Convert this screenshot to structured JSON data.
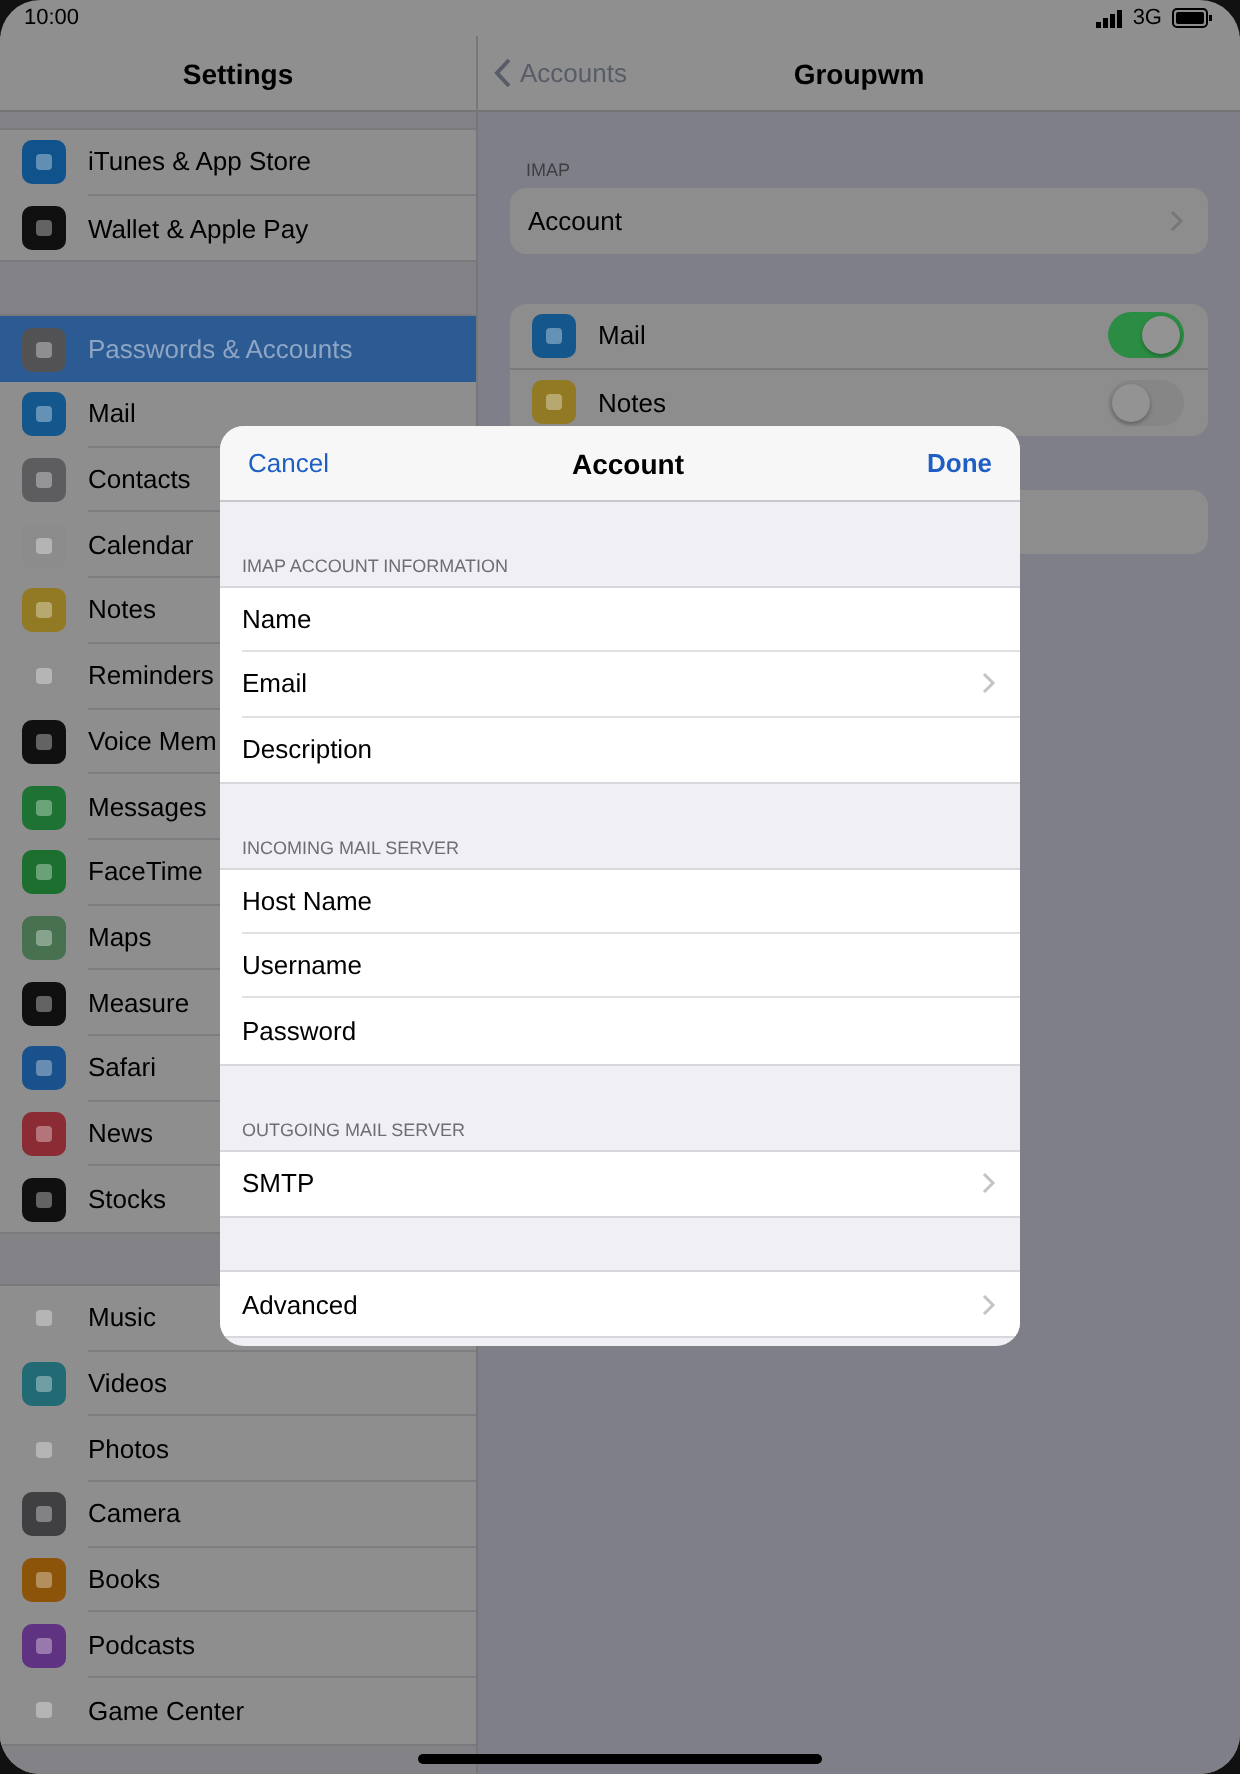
{
  "status_bar": {
    "time": "10:00",
    "network": "3G"
  },
  "sidebar": {
    "title": "Settings",
    "groups": [
      [
        {
          "label": "iTunes & App Store",
          "color": "#10528b",
          "selected": false
        },
        {
          "label": "Wallet & Apple Pay",
          "color": "#101011",
          "selected": false
        }
      ],
      [
        {
          "label": "Passwords & Accounts",
          "color": "#525255",
          "selected": true
        },
        {
          "label": "Mail",
          "color": "#13578d",
          "selected": false
        },
        {
          "label": "Contacts",
          "color": "#5d5d60",
          "selected": false
        },
        {
          "label": "Calendar",
          "color": "#8c8c8c",
          "selected": false
        },
        {
          "label": "Notes",
          "color": "#917a23",
          "selected": false
        },
        {
          "label": "Reminders",
          "color": "#8e8e8e",
          "selected": false
        },
        {
          "label": "Voice Mem",
          "color": "#101011",
          "selected": false
        },
        {
          "label": "Messages",
          "color": "#1e7334",
          "selected": false
        },
        {
          "label": "FaceTime",
          "color": "#1c6f2e",
          "selected": false
        },
        {
          "label": "Maps",
          "color": "#487150",
          "selected": false
        },
        {
          "label": "Measure",
          "color": "#101011",
          "selected": false
        },
        {
          "label": "Safari",
          "color": "#18518b",
          "selected": false
        },
        {
          "label": "News",
          "color": "#8b2b34",
          "selected": false
        },
        {
          "label": "Stocks",
          "color": "#101011",
          "selected": false
        }
      ],
      [
        {
          "label": "Music",
          "color": "#8e8e8f",
          "selected": false
        },
        {
          "label": "Videos",
          "color": "#226b74",
          "selected": false
        },
        {
          "label": "Photos",
          "color": "#8e8e8f",
          "selected": false
        },
        {
          "label": "Camera",
          "color": "#404043",
          "selected": false
        },
        {
          "label": "Books",
          "color": "#8c5409",
          "selected": false
        },
        {
          "label": "Podcasts",
          "color": "#603282",
          "selected": false
        },
        {
          "label": "Game Center",
          "color": "#8e8e8f",
          "selected": false
        }
      ]
    ]
  },
  "detail": {
    "back": "Accounts",
    "title": "Groupwm",
    "section_header": "IMAP",
    "account_row": {
      "label": "Account"
    },
    "apps": [
      {
        "label": "Mail",
        "color": "#13578d",
        "on": true
      },
      {
        "label": "Notes",
        "color": "#917a23",
        "on": false
      }
    ]
  },
  "modal": {
    "cancel": "Cancel",
    "title": "Account",
    "done": "Done",
    "sections": [
      {
        "header": "IMAP ACCOUNT INFORMATION",
        "rows": [
          {
            "label": "Name",
            "chevron": false
          },
          {
            "label": "Email",
            "chevron": true
          },
          {
            "label": "Description",
            "chevron": false
          }
        ]
      },
      {
        "header": "INCOMING MAIL SERVER",
        "rows": [
          {
            "label": "Host Name",
            "chevron": false
          },
          {
            "label": "Username",
            "chevron": false
          },
          {
            "label": "Password",
            "chevron": false
          }
        ]
      },
      {
        "header": "OUTGOING MAIL SERVER",
        "rows": [
          {
            "label": "SMTP",
            "chevron": true
          }
        ]
      },
      {
        "rows": [
          {
            "label": "Advanced",
            "chevron": true
          }
        ]
      }
    ]
  }
}
